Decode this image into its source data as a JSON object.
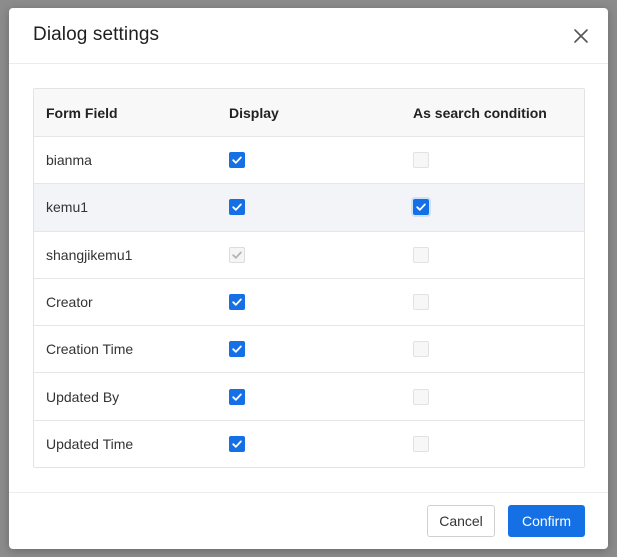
{
  "dialog": {
    "title": "Dialog settings",
    "close_icon": "close-icon"
  },
  "table": {
    "columns": [
      "Form Field",
      "Display",
      "As search condition"
    ],
    "rows": [
      {
        "field": "bianma",
        "display": {
          "checked": true,
          "disabled": false
        },
        "search": {
          "checked": false,
          "disabled": true
        }
      },
      {
        "field": "kemu1",
        "display": {
          "checked": true,
          "disabled": false
        },
        "search": {
          "checked": true,
          "disabled": false,
          "focused": true
        }
      },
      {
        "field": "shangjikemu1",
        "display": {
          "checked": true,
          "disabled": true
        },
        "search": {
          "checked": false,
          "disabled": true
        }
      },
      {
        "field": "Creator",
        "display": {
          "checked": true,
          "disabled": false
        },
        "search": {
          "checked": false,
          "disabled": true
        }
      },
      {
        "field": "Creation Time",
        "display": {
          "checked": true,
          "disabled": false
        },
        "search": {
          "checked": false,
          "disabled": true
        }
      },
      {
        "field": "Updated By",
        "display": {
          "checked": true,
          "disabled": false
        },
        "search": {
          "checked": false,
          "disabled": true
        }
      },
      {
        "field": "Updated Time",
        "display": {
          "checked": true,
          "disabled": false
        },
        "search": {
          "checked": false,
          "disabled": true
        }
      }
    ]
  },
  "footer": {
    "cancel_label": "Cancel",
    "confirm_label": "Confirm"
  },
  "colors": {
    "accent": "#1570e6",
    "overlay": "#8c8c8c"
  }
}
